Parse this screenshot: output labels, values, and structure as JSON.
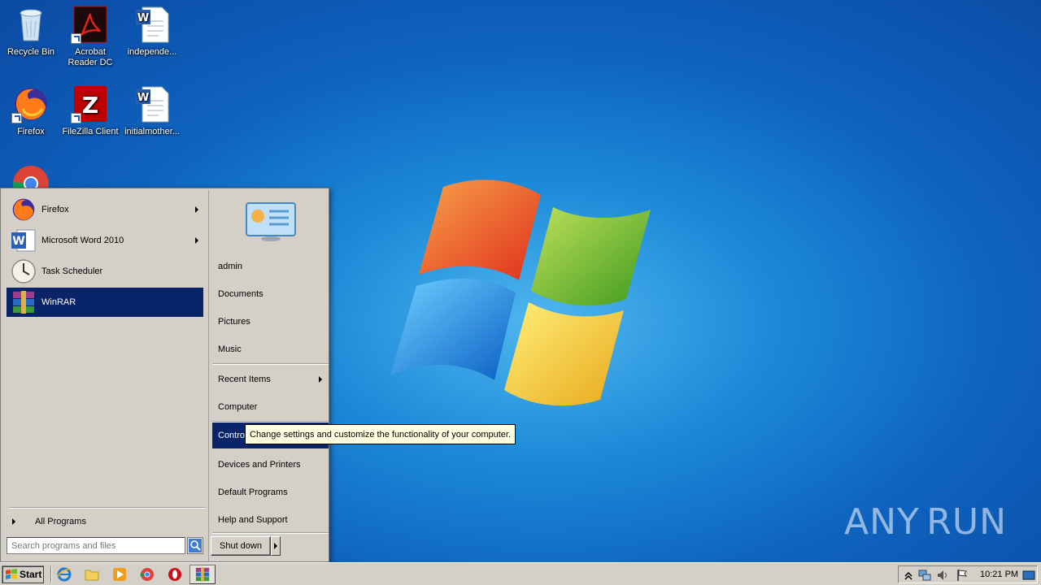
{
  "desktop": {
    "icons": [
      {
        "label": "Recycle Bin",
        "name": "recycle-bin-icon"
      },
      {
        "label": "Acrobat Reader DC",
        "name": "acrobat-reader-icon"
      },
      {
        "label": "independe...",
        "name": "word-document-icon"
      },
      {
        "label": "Firefox",
        "name": "firefox-icon"
      },
      {
        "label": "FileZilla Client",
        "name": "filezilla-icon"
      },
      {
        "label": "initialmother...",
        "name": "word-document-icon"
      },
      {
        "label": "",
        "name": "chrome-icon"
      }
    ],
    "watermark": {
      "left": "ANY",
      "right": "RUN"
    }
  },
  "start_menu": {
    "programs": [
      {
        "label": "Firefox",
        "icon": "firefox-icon",
        "submenu": true
      },
      {
        "label": "Microsoft Word 2010",
        "icon": "word-icon",
        "submenu": true
      },
      {
        "label": "Task Scheduler",
        "icon": "task-scheduler-icon",
        "submenu": false
      },
      {
        "label": "WinRAR",
        "icon": "winrar-icon",
        "submenu": false,
        "selected": true
      }
    ],
    "all_programs": "All Programs",
    "search_placeholder": "Search programs and files",
    "right_items": [
      {
        "label": "admin"
      },
      {
        "label": "Documents"
      },
      {
        "label": "Pictures"
      },
      {
        "label": "Music"
      },
      {
        "label": "Recent Items",
        "submenu": true
      },
      {
        "label": "Computer"
      },
      {
        "label": "Control Panel",
        "selected": true
      },
      {
        "label": "Devices and Printers"
      },
      {
        "label": "Default Programs"
      },
      {
        "label": "Help and Support"
      }
    ],
    "shutdown": "Shut down",
    "tooltip": "Change settings and customize the functionality of your computer."
  },
  "taskbar": {
    "start_label": "Start",
    "quick_launch": [
      "internet-explorer-icon",
      "folder-icon",
      "media-player-icon",
      "chrome-icon",
      "opera-icon"
    ],
    "active_task": "winrar-icon",
    "clock": "10:21 PM"
  },
  "colors": {
    "selection": "#0a246a",
    "menu_face": "#d4d0c8",
    "tooltip_bg": "#ffffe1"
  }
}
